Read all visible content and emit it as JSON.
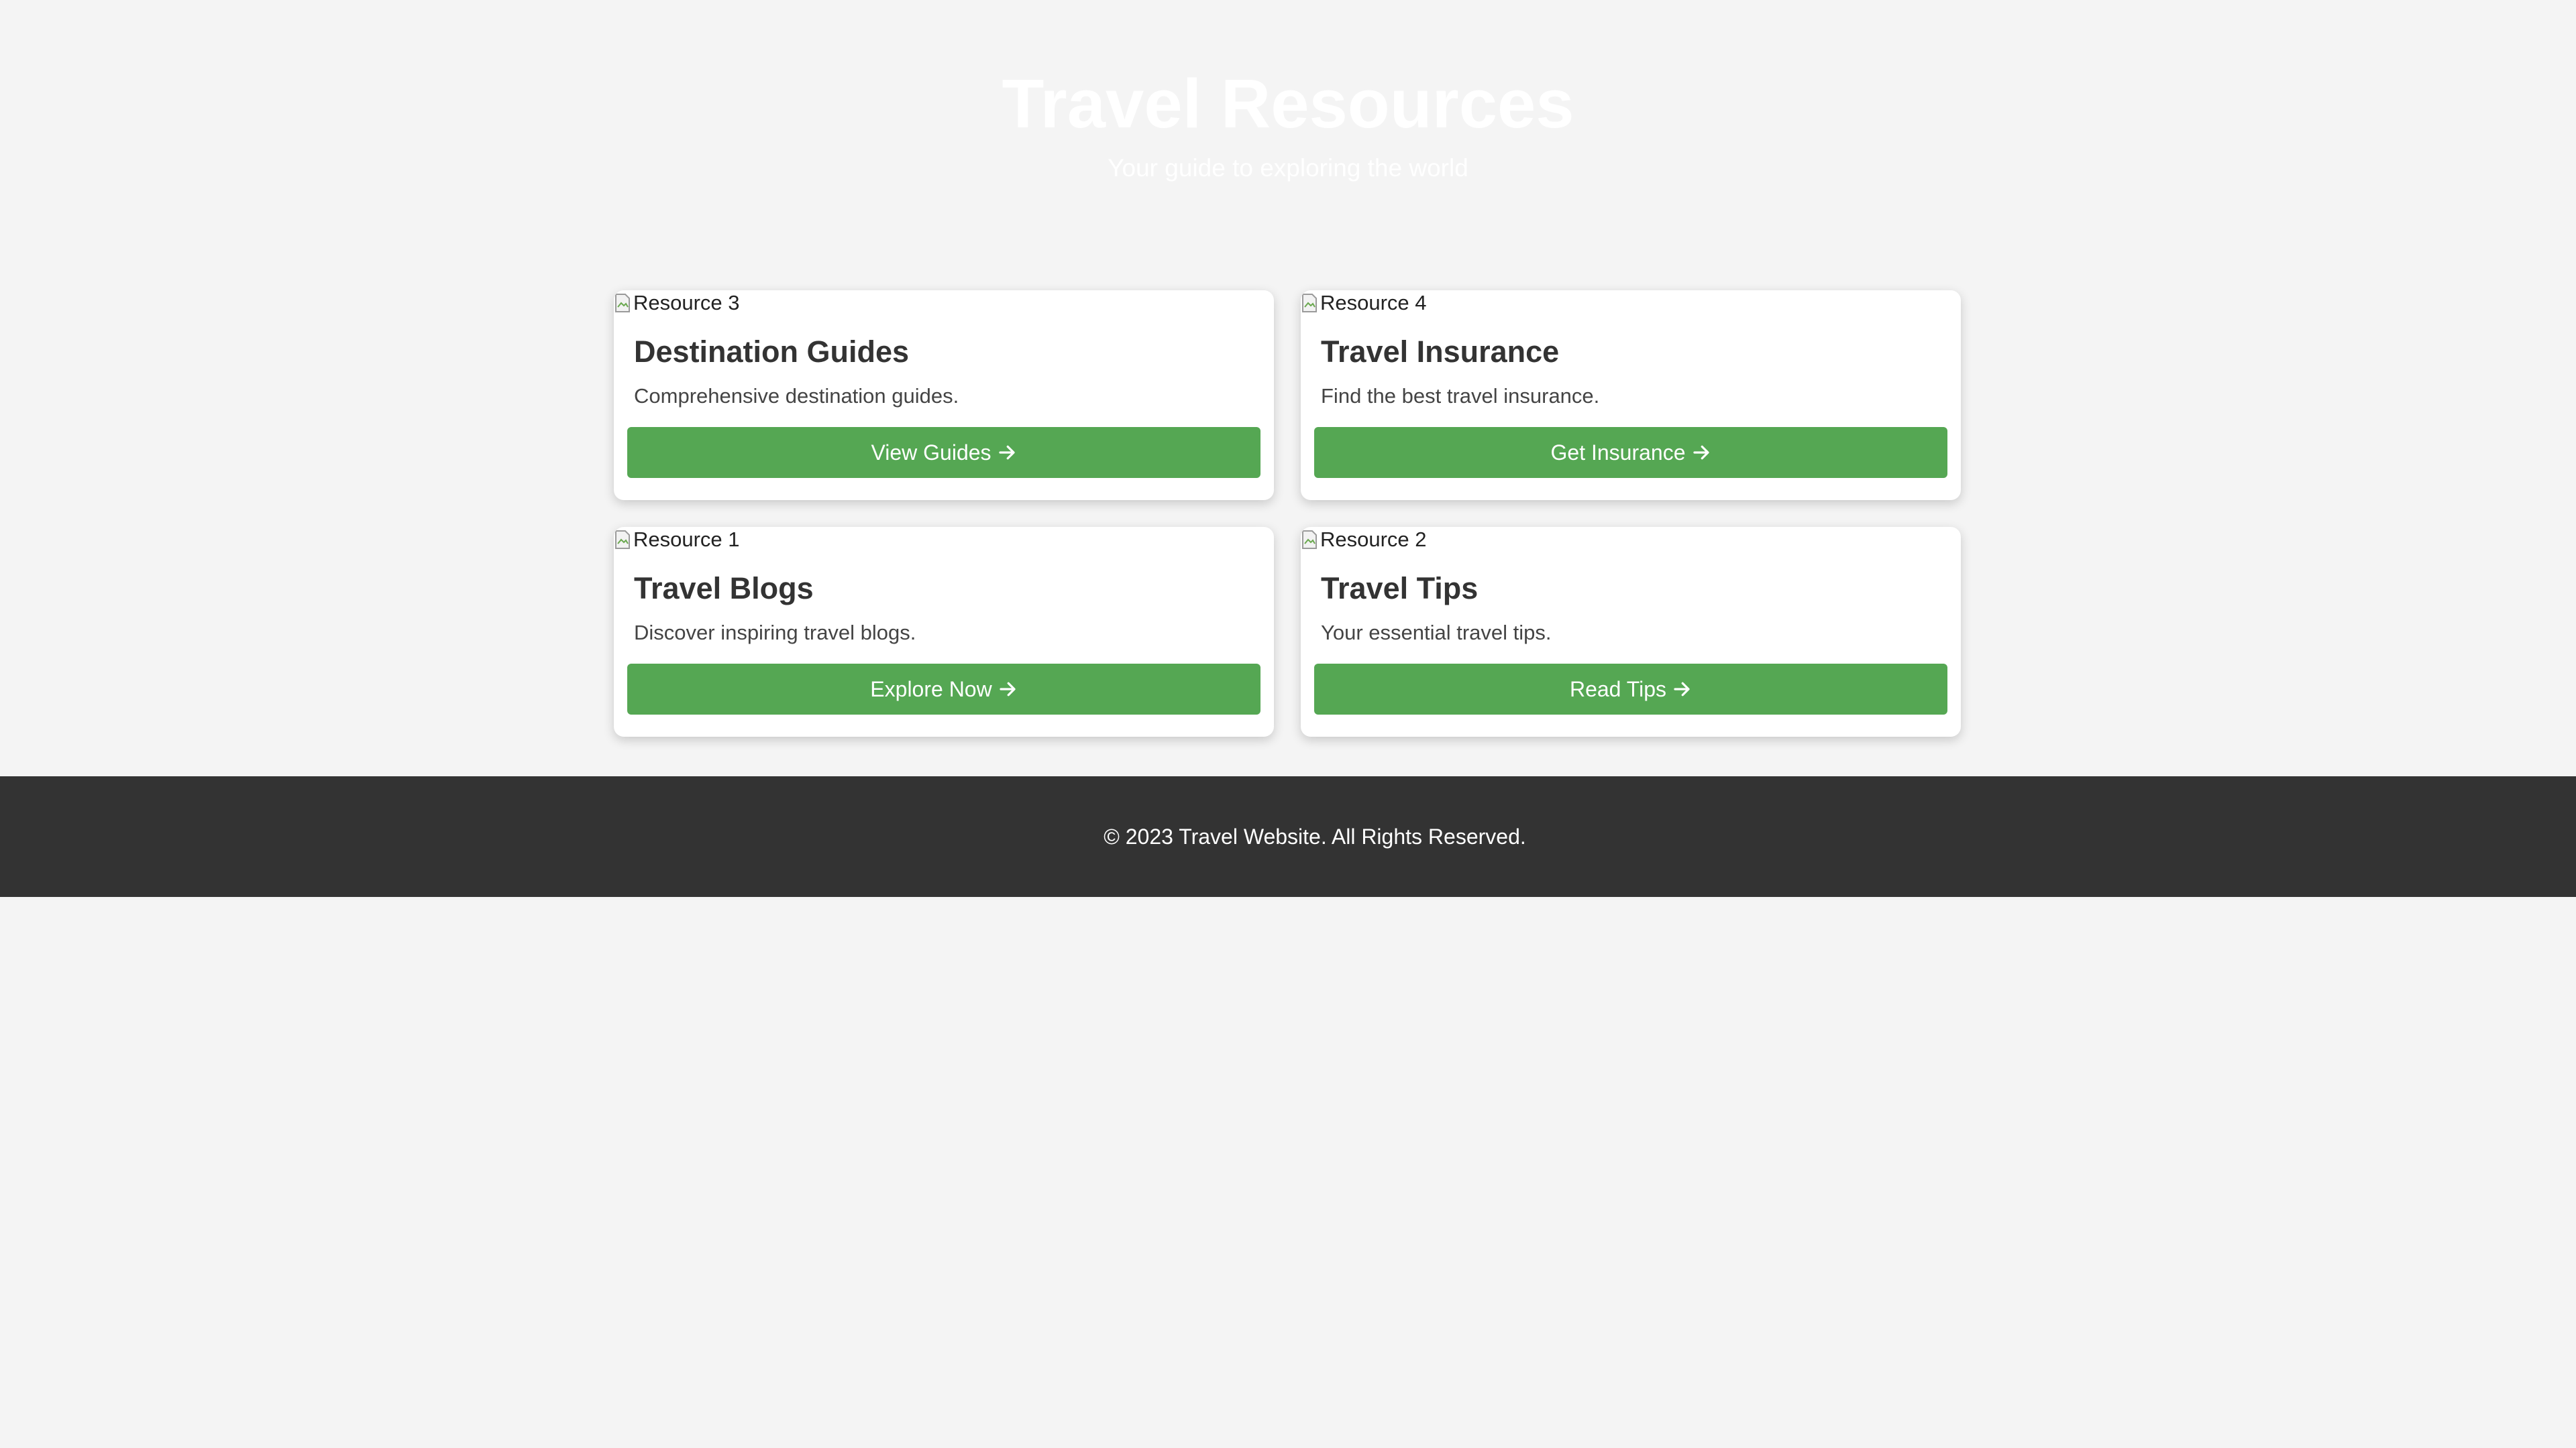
{
  "hero": {
    "title": "Travel Resources",
    "subtitle": "Your guide to exploring the world"
  },
  "cards": [
    {
      "image_alt": "Resource 3",
      "title": "Destination Guides",
      "description": "Comprehensive destination guides.",
      "button_label": "View Guides",
      "button_icon": "arrow-right-icon"
    },
    {
      "image_alt": "Resource 4",
      "title": "Travel Insurance",
      "description": "Find the best travel insurance.",
      "button_label": "Get Insurance",
      "button_icon": "arrow-right-icon"
    },
    {
      "image_alt": "Resource 1",
      "title": "Travel Blogs",
      "description": "Discover inspiring travel blogs.",
      "button_label": "Explore Now",
      "button_icon": "arrow-right-icon"
    },
    {
      "image_alt": "Resource 2",
      "title": "Travel Tips",
      "description": "Your essential travel tips.",
      "button_label": "Read Tips",
      "button_icon": "arrow-right-icon"
    }
  ],
  "footer": {
    "text": "© 2023 Travel Website. All Rights Reserved."
  },
  "colors": {
    "page_background": "#f4f4f4",
    "button": "#55a753",
    "footer_background": "#333333",
    "hero_text": "#ffffff"
  }
}
